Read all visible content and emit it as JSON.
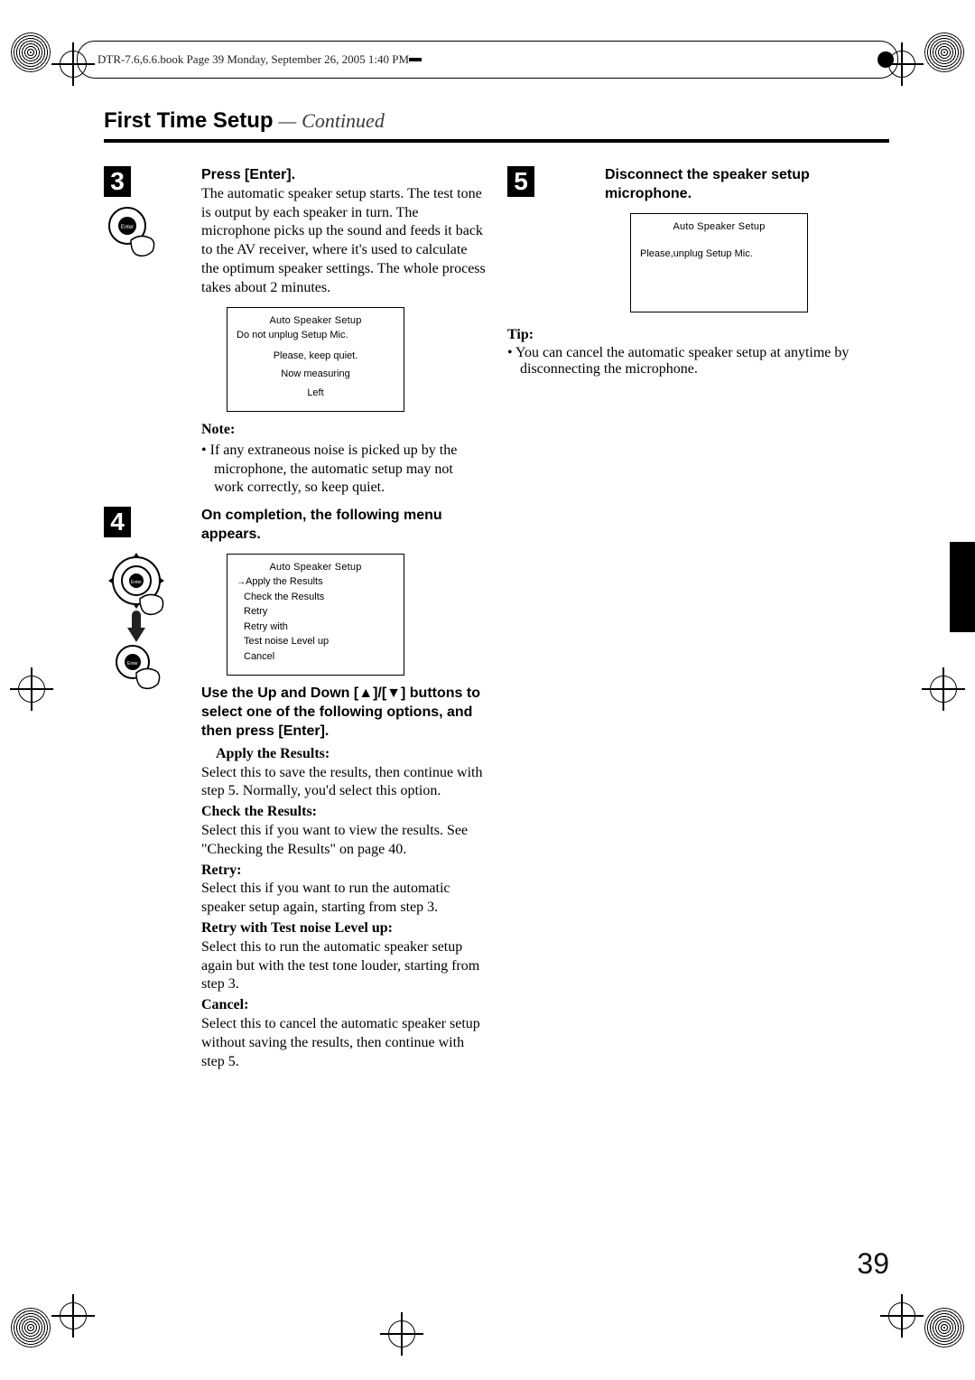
{
  "header": {
    "book_info": "DTR-7.6,6.6.book  Page 39  Monday, September 26, 2005  1:40 PM"
  },
  "page_title": {
    "strong": "First Time Setup",
    "dash": "—",
    "cont": "Continued"
  },
  "left": {
    "step3": {
      "num": "3",
      "headline": "Press [Enter].",
      "body": "The automatic speaker setup starts. The test tone is output by each speaker in turn. The microphone picks up the sound and feeds it back to the AV receiver, where it's used to calculate the optimum speaker settings. The whole process takes about 2 minutes.",
      "osd": {
        "title": "Auto Speaker Setup",
        "line1": "Do not unplug Setup Mic.",
        "line2": "Please, keep quiet.",
        "line3": "Now measuring",
        "line4": "Left"
      },
      "note_label": "Note:",
      "note_body": "If any extraneous noise is picked up by the microphone, the automatic setup may not work correctly, so keep quiet."
    },
    "step4": {
      "num": "4",
      "headline": "On completion, the following menu appears.",
      "osd": {
        "title": "Auto Speaker Setup",
        "opt1": "Apply the Results",
        "opt2": "Check the Results",
        "opt3": "Retry",
        "opt4a": "Retry with",
        "opt4b": " Test noise Level up",
        "opt5": "Cancel"
      },
      "use_line": "Use the Up and Down [▲]/[▼] buttons to select one of the fol­lowing options, and then press [Enter].",
      "opts": {
        "apply_h": "Apply the Results:",
        "apply_b": "Select this to save the results, then con­tinue with step 5. Normally, you'd select this option.",
        "check_h": "Check the Results:",
        "check_b": "Select this if you want to view the results. See \"Checking the Results\" on page 40.",
        "retry_h": "Retry:",
        "retry_b": "Select this if you want to run the auto­matic speaker setup again, starting from step 3.",
        "retryn_h": "Retry with Test noise Level up:",
        "retryn_b": "Select this to run the automatic speaker setup again but with the test tone louder, starting from step 3.",
        "cancel_h": "Cancel:",
        "cancel_b": "Select this to cancel the automatic speaker setup without saving the results, then continue with step 5."
      }
    }
  },
  "right": {
    "step5": {
      "num": "5",
      "headline": "Disconnect the speaker setup microphone.",
      "osd": {
        "title": "Auto Speaker Setup",
        "line1": "Please,unplug Setup Mic."
      }
    },
    "tip_label": "Tip:",
    "tip_body": "You can cancel the automatic speaker setup at anytime by disconnecting the microphone."
  },
  "page_number": "39"
}
